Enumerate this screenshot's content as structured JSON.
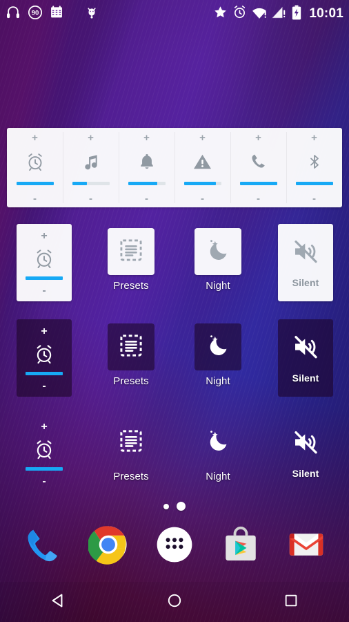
{
  "status_bar": {
    "time": "10:01",
    "left_icons": [
      {
        "name": "headphones-icon",
        "glyph": "headphones"
      },
      {
        "name": "battery-saver-90-icon",
        "glyph": "circle-90",
        "label": "90"
      },
      {
        "name": "calendar-icon",
        "glyph": "calendar"
      },
      {
        "name": "bug-droid-icon",
        "glyph": "creature"
      }
    ],
    "right_icons": [
      {
        "name": "star-icon",
        "glyph": "star"
      },
      {
        "name": "alarm-set-icon",
        "glyph": "alarm"
      },
      {
        "name": "wifi-warning-icon",
        "glyph": "wifi-alert"
      },
      {
        "name": "cell-signal-warning-icon",
        "glyph": "signal-alert"
      },
      {
        "name": "battery-charging-icon",
        "glyph": "battery-bolt"
      }
    ]
  },
  "volume_panel": {
    "name": "volume-panel-widget",
    "plus_label": "+",
    "minus_label": "-",
    "accent_color": "#17a9f5",
    "track_color": "#dfe4e8",
    "channels": [
      {
        "name": "alarm",
        "icon": "alarm-clock-icon",
        "level": 100
      },
      {
        "name": "music",
        "icon": "music-note-icon",
        "level": 40
      },
      {
        "name": "notification",
        "icon": "bell-icon",
        "level": 78
      },
      {
        "name": "system",
        "icon": "warning-icon",
        "level": 86
      },
      {
        "name": "call",
        "icon": "phone-handset-icon",
        "level": 100
      },
      {
        "name": "bluetooth",
        "icon": "bluetooth-icon",
        "level": 100
      }
    ]
  },
  "widget_rows": [
    {
      "theme": "light",
      "volume": {
        "icon": "alarm-clock-icon",
        "level": 100,
        "plus_label": "+",
        "minus_label": "-"
      },
      "tiles": [
        {
          "name": "presets",
          "icon": "presets-list-icon",
          "label": "Presets"
        },
        {
          "name": "night",
          "icon": "moon-star-icon",
          "label": "Night"
        }
      ],
      "silent": {
        "icon": "volume-mute-icon",
        "label": "Silent"
      }
    },
    {
      "theme": "dark",
      "volume": {
        "icon": "alarm-clock-icon",
        "level": 100,
        "plus_label": "+",
        "minus_label": "-"
      },
      "tiles": [
        {
          "name": "presets",
          "icon": "presets-list-icon",
          "label": "Presets"
        },
        {
          "name": "night",
          "icon": "moon-star-icon",
          "label": "Night"
        }
      ],
      "silent": {
        "icon": "volume-mute-icon",
        "label": "Silent"
      }
    },
    {
      "theme": "trans",
      "volume": {
        "icon": "alarm-clock-icon",
        "level": 100,
        "plus_label": "+",
        "minus_label": "-"
      },
      "tiles": [
        {
          "name": "presets",
          "icon": "presets-list-icon",
          "label": "Presets"
        },
        {
          "name": "night",
          "icon": "moon-star-icon",
          "label": "Night"
        }
      ],
      "silent": {
        "icon": "volume-mute-icon",
        "label": "Silent"
      }
    }
  ],
  "page_indicator": {
    "count": 2,
    "active_index": 1
  },
  "dock": {
    "items": [
      {
        "name": "phone-app",
        "icon": "phone-icon"
      },
      {
        "name": "chrome-app",
        "icon": "chrome-icon"
      },
      {
        "name": "app-drawer",
        "icon": "apps-grid-icon"
      },
      {
        "name": "play-store-app",
        "icon": "play-store-icon"
      },
      {
        "name": "gmail-app",
        "icon": "gmail-icon"
      }
    ]
  },
  "nav_bar": {
    "items": [
      {
        "name": "back-button",
        "icon": "back-triangle-icon"
      },
      {
        "name": "home-button",
        "icon": "home-circle-icon"
      },
      {
        "name": "recents-button",
        "icon": "recents-square-icon"
      }
    ]
  }
}
